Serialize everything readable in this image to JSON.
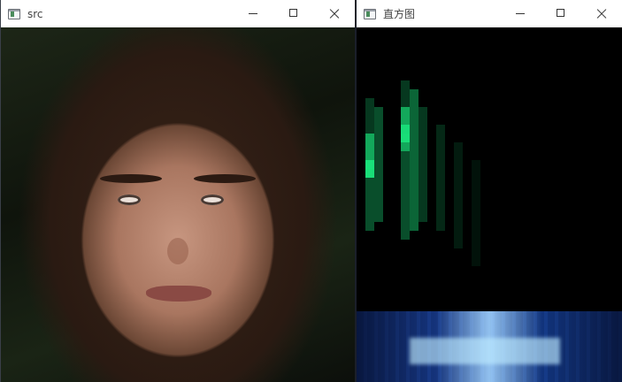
{
  "windows": {
    "src": {
      "title": "src"
    },
    "hist": {
      "title": "直方图"
    }
  },
  "icons": {
    "app": "app-window-icon",
    "minimize": "minimize-icon",
    "maximize": "maximize-icon",
    "close": "close-icon"
  },
  "colors": {
    "histogram_background": "#000000",
    "histogram_accent": "#19e07a",
    "desktop_accent": "#1a3b86"
  }
}
